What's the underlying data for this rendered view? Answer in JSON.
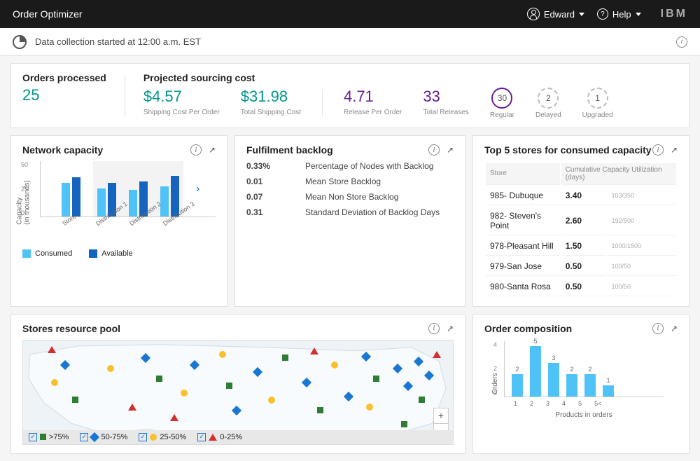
{
  "header": {
    "app_title": "Order Optimizer",
    "user_name": "Edward",
    "help_label": "Help",
    "brand": "IBM"
  },
  "subheader": {
    "status_text": "Data collection started at 12:00 a.m. EST"
  },
  "kpi": {
    "orders_processed_label": "Orders processed",
    "orders_processed_value": "25",
    "projected_label": "Projected sourcing cost",
    "ship_cost_per_order": "$4.57",
    "ship_cost_per_order_label": "Shipping Cost Per Order",
    "total_ship_cost": "$31.98",
    "total_ship_cost_label": "Total Shipping Cost",
    "release_per_order": "4.71",
    "release_per_order_label": "Release Per Order",
    "total_releases": "33",
    "total_releases_label": "Total Releases",
    "regular_value": "30",
    "regular_label": "Regular",
    "delayed_value": "2",
    "delayed_label": "Delayed",
    "upgraded_value": "1",
    "upgraded_label": "Upgraded"
  },
  "network": {
    "title": "Network capacity",
    "y_axis": "Capacity\n(in thousands)",
    "ticks": [
      "50",
      "25",
      "0"
    ],
    "legend_consumed": "Consumed",
    "legend_available": "Available",
    "cats": [
      "Store",
      "Distribution 1",
      "Distribution 2",
      "Distribution 3"
    ]
  },
  "backlog": {
    "title": "Fulfilment backlog",
    "rows": [
      {
        "v": "0.33%",
        "l": "Percentage of Nodes with Backlog"
      },
      {
        "v": "0.01",
        "l": "Mean Store Backlog"
      },
      {
        "v": "0.07",
        "l": "Mean Non Store Backlog"
      },
      {
        "v": "0.31",
        "l": "Standard Deviation of Backlog Days"
      }
    ]
  },
  "top5": {
    "title": "Top 5 stores for consumed capacity",
    "col_store": "Store",
    "col_util": "Cumulative Capacity Utilization (days)",
    "rows": [
      {
        "name": "985- Dubuque",
        "val": "3.40",
        "ratio": "103/350"
      },
      {
        "name": "982- Steven's Point",
        "val": "2.60",
        "ratio": "192/500"
      },
      {
        "name": "978-Pleasant Hill",
        "val": "1.50",
        "ratio": "1000/1500"
      },
      {
        "name": "979-San Jose",
        "val": "0.50",
        "ratio": "100/50"
      },
      {
        "name": "980-Santa Rosa",
        "val": "0.50",
        "ratio": "100/50"
      }
    ]
  },
  "map": {
    "title": "Stores resource pool",
    "legend": {
      "a": ">75%",
      "b": "50-75%",
      "c": "25-50%",
      "d": "0-25%"
    }
  },
  "order_comp": {
    "title": "Order composition",
    "xlabel": "Products in orders",
    "ylabel": "Orders",
    "yticks": [
      "4",
      "2",
      "0"
    ]
  },
  "chart_data": [
    {
      "id": "network_capacity",
      "type": "bar",
      "title": "Network capacity",
      "ylabel": "Capacity (in thousands)",
      "ylim": [
        0,
        50
      ],
      "categories": [
        "Store",
        "Distribution 1",
        "Distribution 2",
        "Distribution 3"
      ],
      "series": [
        {
          "name": "Consumed",
          "values": [
            30,
            25,
            24,
            27
          ]
        },
        {
          "name": "Available",
          "values": [
            35,
            30,
            31,
            36
          ]
        }
      ]
    },
    {
      "id": "order_composition",
      "type": "bar",
      "title": "Order composition",
      "xlabel": "Products in orders",
      "ylabel": "Orders",
      "ylim": [
        0,
        5
      ],
      "categories": [
        "1",
        "2",
        "3",
        "4",
        "5",
        "5<"
      ],
      "values": [
        2,
        5,
        3,
        2,
        2,
        1
      ]
    }
  ]
}
